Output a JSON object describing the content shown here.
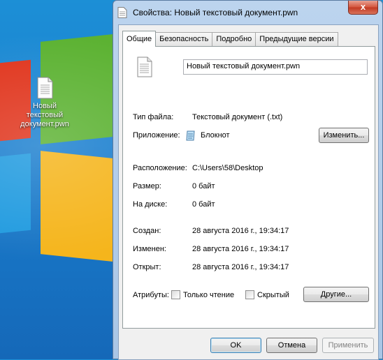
{
  "desktop": {
    "icon_label": "Новый текстовый документ.pwn"
  },
  "window": {
    "title": "Свойства: Новый текстовый документ.pwn",
    "close_label": "x",
    "tabs": [
      {
        "label": "Общие",
        "active": true
      },
      {
        "label": "Безопасность",
        "active": false
      },
      {
        "label": "Подробно",
        "active": false
      },
      {
        "label": "Предыдущие версии",
        "active": false
      }
    ],
    "general": {
      "file_name": "Новый текстовый документ.pwn",
      "type_label": "Тип файла:",
      "type_value": "Текстовый документ (.txt)",
      "app_label": "Приложение:",
      "app_value": "Блокнот",
      "change_button": "Изменить...",
      "location_label": "Расположение:",
      "location_value": "C:\\Users\\58\\Desktop",
      "size_label": "Размер:",
      "size_value": "0 байт",
      "disk_label": "На диске:",
      "disk_value": "0 байт",
      "created_label": "Создан:",
      "created_value": "28 августа 2016 г., 19:34:17",
      "modified_label": "Изменен:",
      "modified_value": "28 августа 2016 г., 19:34:17",
      "opened_label": "Открыт:",
      "opened_value": "28 августа 2016 г., 19:34:17",
      "attributes_label": "Атрибуты:",
      "readonly_label": "Только чтение",
      "readonly_checked": false,
      "hidden_label": "Скрытый",
      "hidden_checked": false,
      "other_button": "Другие..."
    },
    "footer": {
      "ok": "OK",
      "cancel": "Отмена",
      "apply": "Применить"
    }
  },
  "colors": {
    "desktop_blue": "#1a7fcf",
    "pane_red": "#e0341c",
    "pane_green": "#5cb232",
    "pane_yellow": "#f5b51c",
    "close_red": "#c23a23"
  }
}
